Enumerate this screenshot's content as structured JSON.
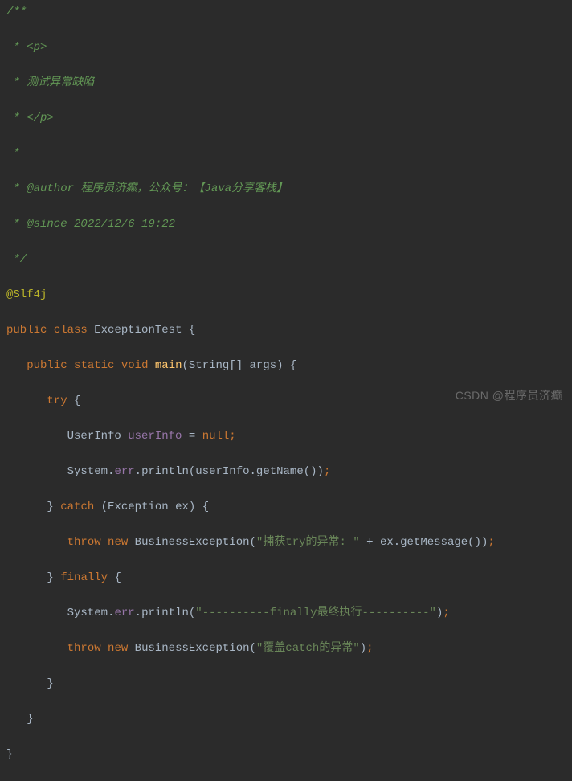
{
  "comment": {
    "start": "/**",
    "p_open": " * <p>",
    "desc": " * 测试异常缺陷",
    "p_close": " * </p>",
    "blank": " *",
    "author": " * @author 程序员济癫，公众号：【Java分享客栈】",
    "since": " * @since 2022/12/6 19:22",
    "end": " */"
  },
  "annotation": "@Slf4j",
  "code": {
    "public": "public",
    "class": "class",
    "classname": "ExceptionTest",
    "static": "static",
    "void": "void",
    "main": "main",
    "string_arr": "String[]",
    "args": "args",
    "try": "try",
    "userinfo_type": "UserInfo",
    "userinfo_var": "userInfo",
    "null": "null",
    "system": "System",
    "err": "err",
    "println": "println",
    "getname": "getName",
    "catch": "catch",
    "exception": "Exception",
    "ex": "ex",
    "throw": "throw",
    "new": "new",
    "biz_exception": "BusinessException",
    "str_try": "\"捕获try的异常: \"",
    "plus": " + ",
    "getmessage": "getMessage",
    "finally": "finally",
    "str_finally": "\"----------finally最终执行----------\"",
    "str_catch": "\"覆盖catch的异常\""
  },
  "watermark": "CSDN @程序员济癫"
}
